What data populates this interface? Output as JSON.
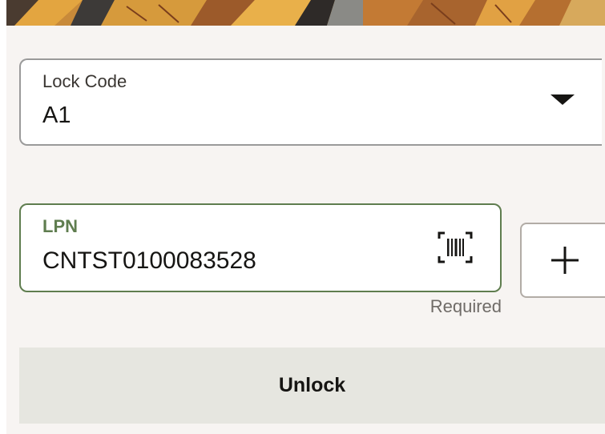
{
  "lock_code": {
    "label": "Lock Code",
    "value": "A1",
    "icon": "caret-down-icon"
  },
  "lpn": {
    "label": "LPN",
    "value": "CNTST0100083528",
    "helper": "Required",
    "scan_icon": "barcode-scan-icon",
    "add_icon": "plus-icon"
  },
  "actions": {
    "unlock_label": "Unlock"
  },
  "colors": {
    "accent_green": "#5f7d4f",
    "panel_background": "#f7f4f2",
    "button_background": "#e6e6e0"
  }
}
